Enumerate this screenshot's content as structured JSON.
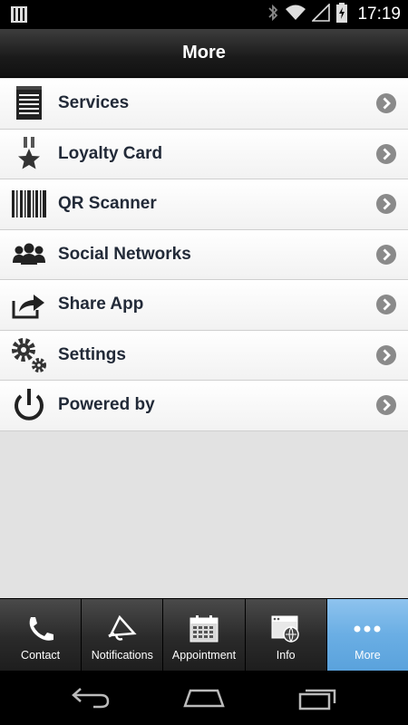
{
  "status_bar": {
    "time": "17:19",
    "icons": [
      "sim-card-icon",
      "bluetooth-icon",
      "wifi-icon",
      "signal-icon",
      "battery-charging-icon"
    ]
  },
  "header": {
    "title": "More"
  },
  "menu": {
    "items": [
      {
        "label": "Services",
        "icon": "notepad-icon"
      },
      {
        "label": "Loyalty Card",
        "icon": "medal-star-icon"
      },
      {
        "label": "QR Scanner",
        "icon": "barcode-icon"
      },
      {
        "label": "Social Networks",
        "icon": "people-group-icon"
      },
      {
        "label": "Share App",
        "icon": "share-arrow-icon"
      },
      {
        "label": "Settings",
        "icon": "gears-icon"
      },
      {
        "label": "Powered by",
        "icon": "power-icon"
      }
    ]
  },
  "tab_bar": {
    "tabs": [
      {
        "label": "Contact",
        "icon": "phone-icon",
        "active": false
      },
      {
        "label": "Notifications",
        "icon": "megaphone-icon",
        "active": false
      },
      {
        "label": "Appointment",
        "icon": "calendar-icon",
        "active": false
      },
      {
        "label": "Info",
        "icon": "browser-globe-icon",
        "active": false
      },
      {
        "label": "More",
        "icon": "more-dots-icon",
        "active": true
      }
    ]
  },
  "colors": {
    "active_tab": "#6aaee4",
    "menu_text": "#222a38",
    "chevron": "#888888"
  }
}
